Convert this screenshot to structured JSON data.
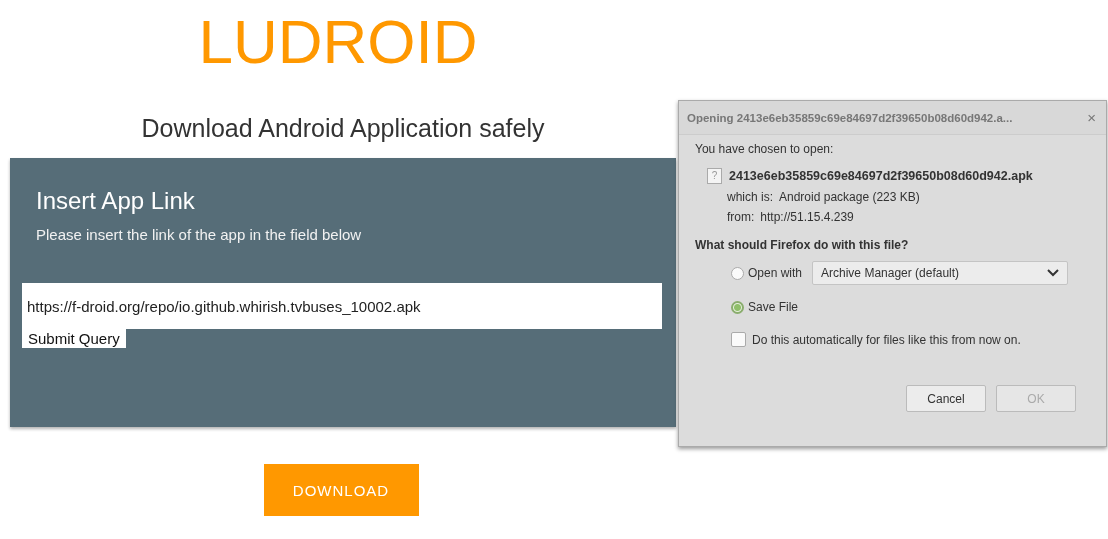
{
  "logo": "LUDROID",
  "subtitle": "Download Android Application safely",
  "card": {
    "title": "Insert App Link",
    "description": "Please insert the link of the app in the field below",
    "link_value": "https://f-droid.org/repo/io.github.whirish.tvbuses_10002.apk",
    "submit": "Submit Query"
  },
  "download_button": "DOWNLOAD",
  "dialog": {
    "title": "Opening 2413e6eb35859c69e84697d2f39650b08d60d942.a...",
    "close": "×",
    "intro": "You have chosen to open:",
    "file_icon": "?",
    "file_name": "2413e6eb35859c69e84697d2f39650b08d60d942.apk",
    "details": [
      {
        "label": "which is:",
        "value": "Android package (223 KB)"
      },
      {
        "label": "from:",
        "value": "http://51.15.4.239"
      }
    ],
    "question": "What should Firefox do with this file?",
    "options": [
      {
        "label": "Open with",
        "selected": false,
        "app": "Archive Manager (default)"
      },
      {
        "label": "Save File",
        "selected": true
      }
    ],
    "auto": {
      "label": "Do this automatically for files like this from now on.",
      "checked": false
    },
    "buttons": [
      {
        "label": "Cancel",
        "disabled": false
      },
      {
        "label": "OK",
        "disabled": true
      }
    ]
  }
}
